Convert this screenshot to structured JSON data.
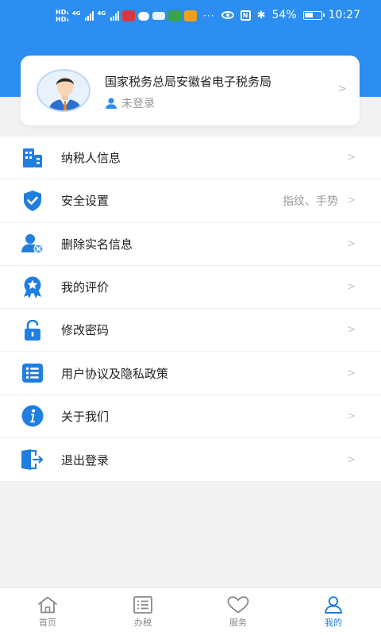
{
  "colors": {
    "brand": "#2b8ef0",
    "icon": "#1f7fe0",
    "active_tab": "#1f7fe0"
  },
  "status_bar": {
    "left_icons": [
      "hd-volte-icon",
      "signal-4g-icon",
      "signal-4g-icon",
      "app-notification-icons"
    ],
    "battery": "54%",
    "battery_level": 0.54,
    "time": "10:27"
  },
  "profile": {
    "org_name": "国家税务总局安徽省电子税务局",
    "login_status": "未登录",
    "avatar_icon": "user-avatar-icon"
  },
  "menu": {
    "items": [
      {
        "label": "纳税人信息",
        "value": "",
        "icon": "building-icon"
      },
      {
        "label": "安全设置",
        "value": "指纹、手势",
        "icon": "shield-check-icon"
      },
      {
        "label": "删除实名信息",
        "value": "",
        "icon": "user-remove-icon"
      },
      {
        "label": "我的评价",
        "value": "",
        "icon": "star-badge-icon"
      },
      {
        "label": "修改密码",
        "value": "",
        "icon": "lock-icon"
      },
      {
        "label": "用户协议及隐私政策",
        "value": "",
        "icon": "list-icon"
      },
      {
        "label": "关于我们",
        "value": "",
        "icon": "info-icon"
      },
      {
        "label": "退出登录",
        "value": "",
        "icon": "logout-icon"
      }
    ],
    "chevron": ">"
  },
  "tabbar": {
    "tabs": [
      {
        "label": "首页",
        "icon": "home-icon",
        "active": false
      },
      {
        "label": "办税",
        "icon": "list-icon",
        "active": false
      },
      {
        "label": "服务",
        "icon": "heart-icon",
        "active": false
      },
      {
        "label": "我的",
        "icon": "person-icon",
        "active": true
      }
    ]
  }
}
